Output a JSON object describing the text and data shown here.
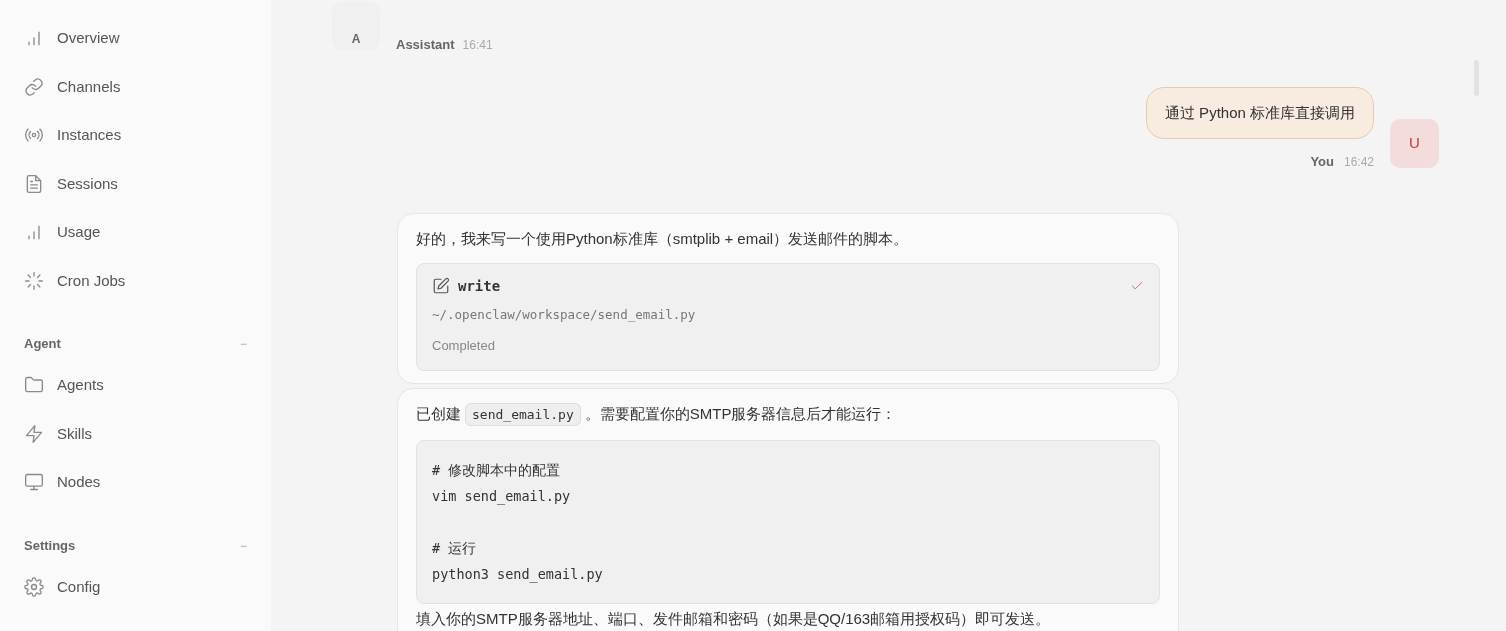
{
  "sidebar": {
    "sections": [
      {
        "items": [
          {
            "label": "Overview"
          },
          {
            "label": "Channels"
          },
          {
            "label": "Instances"
          },
          {
            "label": "Sessions"
          },
          {
            "label": "Usage"
          },
          {
            "label": "Cron Jobs"
          }
        ]
      },
      {
        "title": "Agent",
        "toggle": "−",
        "items": [
          {
            "label": "Agents"
          },
          {
            "label": "Skills"
          },
          {
            "label": "Nodes"
          }
        ]
      },
      {
        "title": "Settings",
        "toggle": "−",
        "items": [
          {
            "label": "Config"
          }
        ]
      }
    ]
  },
  "chat": {
    "messages": [
      {
        "kind": "header",
        "avatar": "A",
        "name": "Assistant",
        "time": "16:41"
      },
      {
        "kind": "user",
        "text": "通过 Python 标准库直接调用",
        "avatar": "U",
        "name": "You",
        "time": "16:42"
      },
      {
        "kind": "card",
        "blocks": [
          {
            "kind": "text",
            "parts": [
              {
                "kind": "text",
                "text": "好的，我来写一个使用Python标准库（smtplib + email）发送邮件的脚本。"
              }
            ]
          },
          {
            "kind": "tool",
            "name": "write",
            "path": "~/.openclaw/workspace/send_email.py",
            "status": "Completed",
            "done": true
          }
        ]
      },
      {
        "kind": "card",
        "blocks": [
          {
            "kind": "text",
            "parts": [
              {
                "kind": "text",
                "text": "已创建"
              },
              {
                "kind": "code",
                "text": "send_email.py"
              },
              {
                "kind": "text",
                "text": "。需要配置你的SMTP服务器信息后才能运行："
              }
            ]
          },
          {
            "kind": "code",
            "groups": [
              [
                "# 修改脚本中的配置",
                "vim send_email.py"
              ],
              [
                "# 运行",
                "python3 send_email.py"
              ]
            ]
          },
          {
            "kind": "text",
            "parts": [
              {
                "kind": "text",
                "text": "填入你的SMTP服务器地址、端口、发件邮箱和密码（如果是QQ/163邮箱用授权码）即可发送。"
              }
            ]
          }
        ]
      }
    ]
  }
}
